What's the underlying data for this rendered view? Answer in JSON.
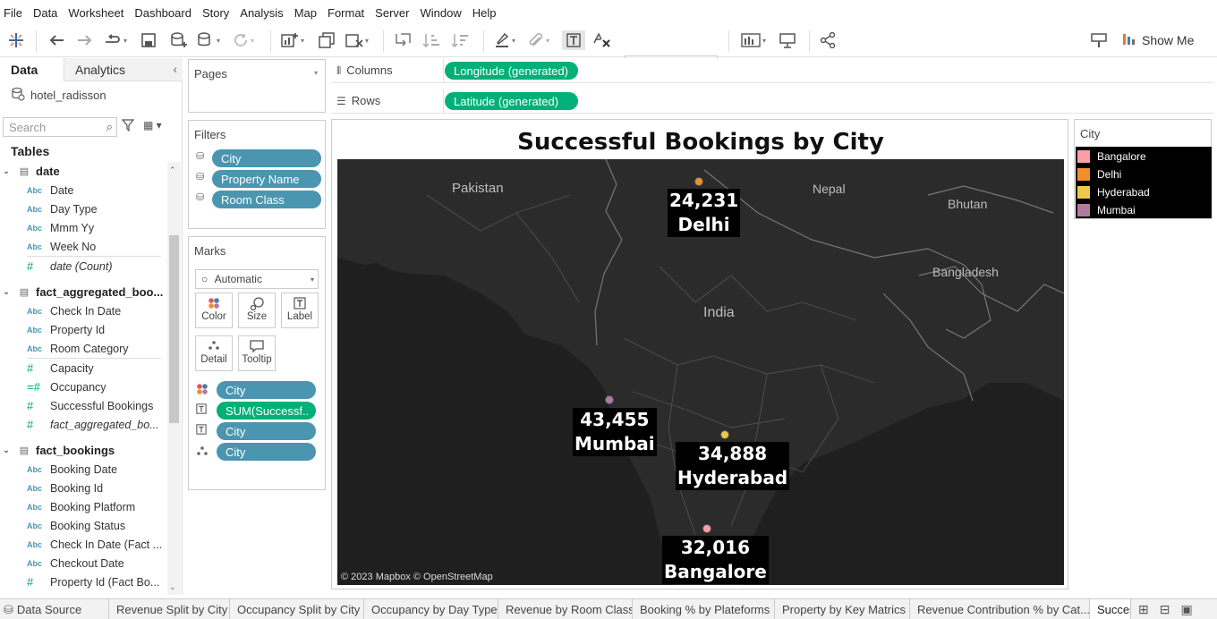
{
  "menu": [
    "File",
    "Data",
    "Worksheet",
    "Dashboard",
    "Story",
    "Analysis",
    "Map",
    "Format",
    "Server",
    "Window",
    "Help"
  ],
  "toolbar": {
    "show_me": "Show Me"
  },
  "left_pane": {
    "tab_data": "Data",
    "tab_analytics": "Analytics",
    "datasource": "hotel_radisson",
    "search_placeholder": "Search",
    "tables_heading": "Tables",
    "groups": [
      {
        "name": "date",
        "fields": [
          {
            "type": "Abc",
            "name": "Date"
          },
          {
            "type": "Abc",
            "name": "Day Type"
          },
          {
            "type": "Abc",
            "name": "Mmm Yy"
          },
          {
            "type": "Abc",
            "name": "Week No"
          },
          {
            "type": "#",
            "name": "date (Count)",
            "italic": true
          }
        ]
      },
      {
        "name": "fact_aggregated_boo...",
        "fields": [
          {
            "type": "Abc",
            "name": "Check In Date"
          },
          {
            "type": "Abc",
            "name": "Property Id"
          },
          {
            "type": "Abc",
            "name": "Room Category"
          },
          {
            "type": "#",
            "name": "Capacity"
          },
          {
            "type": "=#",
            "name": "Occupancy"
          },
          {
            "type": "#",
            "name": "Successful Bookings"
          },
          {
            "type": "#",
            "name": "fact_aggregated_bo...",
            "italic": true
          }
        ]
      },
      {
        "name": "fact_bookings",
        "fields": [
          {
            "type": "Abc",
            "name": "Booking Date"
          },
          {
            "type": "Abc",
            "name": "Booking Id"
          },
          {
            "type": "Abc",
            "name": "Booking Platform"
          },
          {
            "type": "Abc",
            "name": "Booking Status"
          },
          {
            "type": "Abc",
            "name": "Check In Date (Fact ..."
          },
          {
            "type": "Abc",
            "name": "Checkout Date"
          },
          {
            "type": "#",
            "name": "Property Id (Fact Bo..."
          }
        ]
      }
    ]
  },
  "pages_card": {
    "title": "Pages"
  },
  "filters_card": {
    "title": "Filters",
    "pills": [
      "City",
      "Property Name",
      "Room Class"
    ]
  },
  "marks_card": {
    "title": "Marks",
    "mark_type": "Automatic",
    "buttons": [
      "Color",
      "Size",
      "Label",
      "Detail",
      "Tooltip"
    ],
    "pills": [
      {
        "icon": "color",
        "label": "City",
        "kind": "dimension"
      },
      {
        "icon": "label",
        "label": "SUM(Successf..",
        "kind": "measure"
      },
      {
        "icon": "label",
        "label": "City",
        "kind": "dimension"
      },
      {
        "icon": "detail",
        "label": "City",
        "kind": "dimension"
      }
    ]
  },
  "shelves": {
    "columns_label": "Columns",
    "columns_pill": "Longitude (generated)",
    "rows_label": "Rows",
    "rows_pill": "Latitude (generated)"
  },
  "view": {
    "title": "Successful Bookings by City",
    "map_countries": [
      "Pakistan",
      "Nepal",
      "Bhutan",
      "India",
      "Bangladesh"
    ],
    "attribution": "© 2023 Mapbox © OpenStreetMap",
    "points": [
      {
        "city": "Delhi",
        "value": "24,231",
        "color": "#f28e2b"
      },
      {
        "city": "Mumbai",
        "value": "43,455",
        "color": "#b07aa1"
      },
      {
        "city": "Hyderabad",
        "value": "34,888",
        "color": "#edc948"
      },
      {
        "city": "Bangalore",
        "value": "32,016",
        "color": "#ff9da7"
      }
    ]
  },
  "legend": {
    "title": "City",
    "items": [
      {
        "label": "Bangalore",
        "color": "#ff9da7"
      },
      {
        "label": "Delhi",
        "color": "#f28e2b"
      },
      {
        "label": "Hyderabad",
        "color": "#edc948"
      },
      {
        "label": "Mumbai",
        "color": "#b07aa1"
      }
    ]
  },
  "bottom_tabs": [
    "Data Source",
    "Revenue Split by City",
    "Occupancy Split by City",
    "Occupancy by Day Type",
    "Revenue by Room Class",
    "Booking % by Plateforms",
    "Property by Key Matrics",
    "Revenue Contribution % by Cat...",
    "Succes"
  ],
  "active_tab_index": 8
}
